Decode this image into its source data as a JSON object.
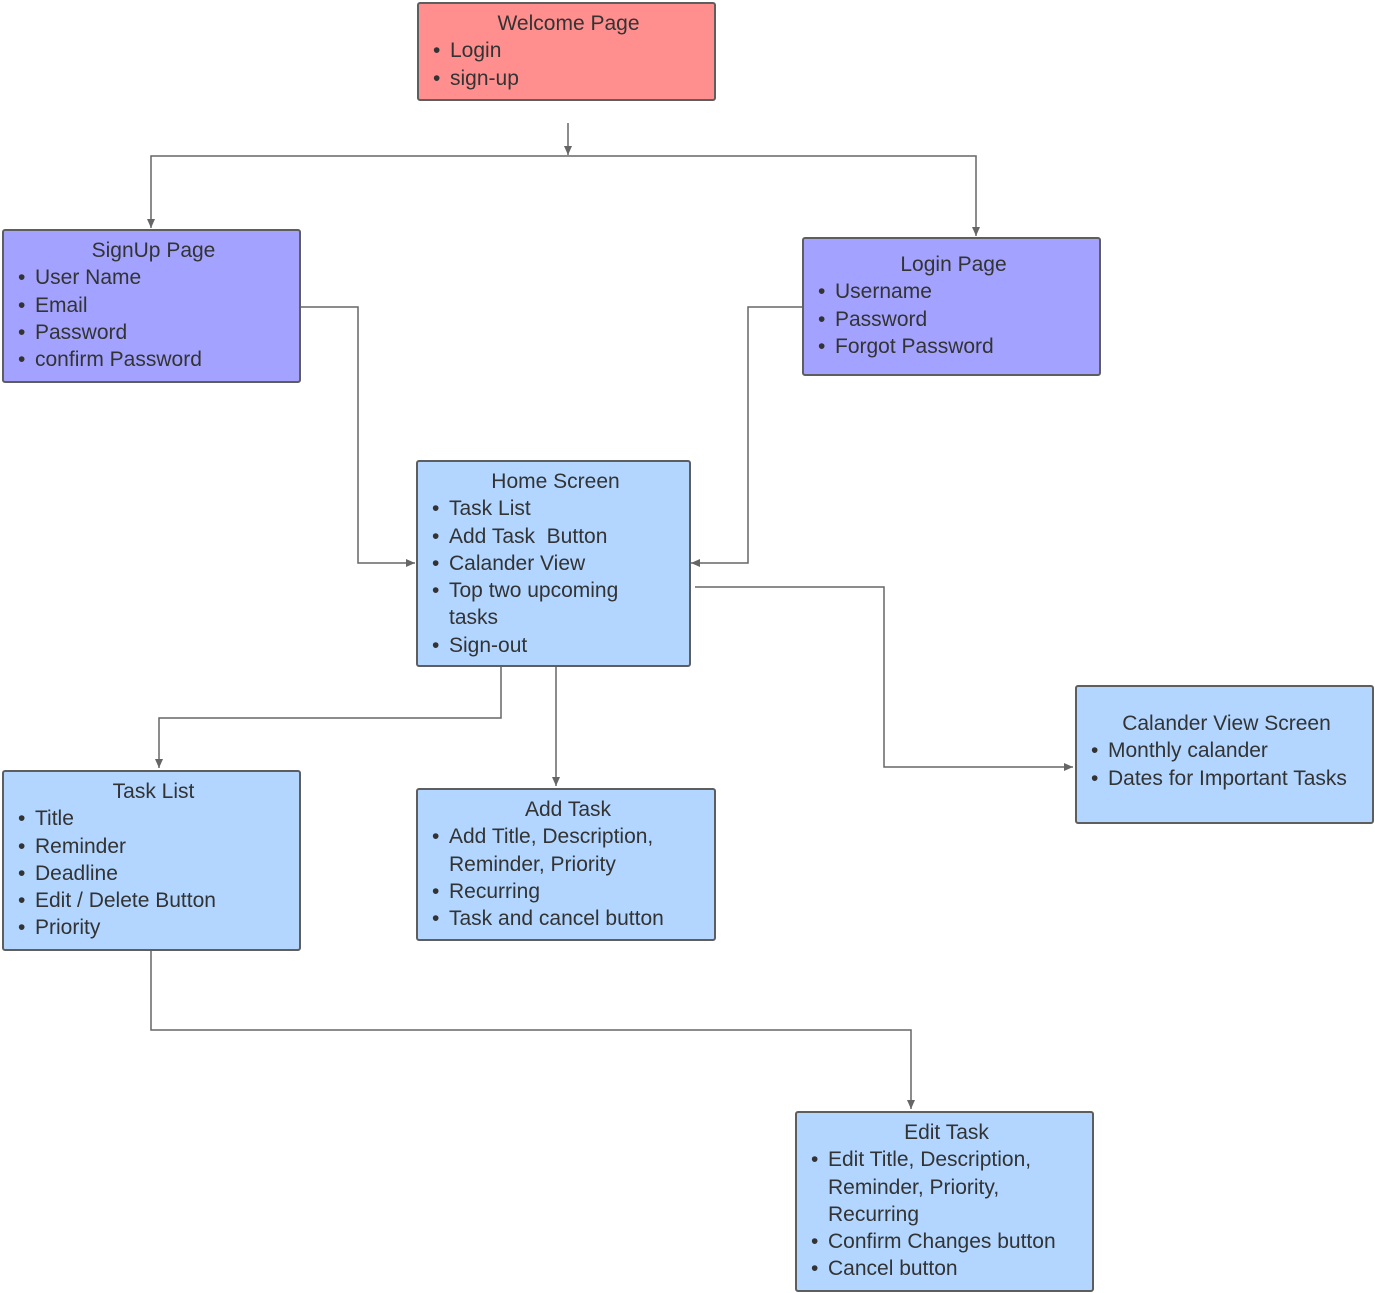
{
  "colors": {
    "welcome": "#FF8F8F",
    "auth": "#A3A3FF",
    "screen": "#B2D6FF",
    "border": "#5E5E5E",
    "connector": "#666666"
  },
  "nodes": {
    "welcome": {
      "title": "Welcome Page",
      "items": [
        "Login",
        "sign-up"
      ]
    },
    "signup": {
      "title": "SignUp Page",
      "items": [
        "User Name",
        "Email",
        "Password",
        "confirm Password"
      ]
    },
    "login": {
      "title": "Login Page",
      "items": [
        "Username",
        "Password",
        "Forgot Password"
      ]
    },
    "home": {
      "title": "Home Screen",
      "items": [
        "Task List",
        "Add Task  Button",
        "Calander View",
        "Top two upcoming tasks",
        "Sign-out"
      ]
    },
    "tasklist": {
      "title": "Task List",
      "items": [
        "Title",
        "Reminder",
        "Deadline",
        "Edit / Delete Button",
        "Priority"
      ]
    },
    "addtask": {
      "title": "Add Task",
      "items": [
        "Add Title, Description, Reminder, Priority",
        "Recurring",
        "Task and cancel button"
      ]
    },
    "calendar": {
      "title": "Calander View Screen",
      "items": [
        "Monthly calander",
        "Dates for Important Tasks"
      ]
    },
    "edittask": {
      "title": "Edit Task",
      "items": [
        "Edit Title, Description, Reminder, Priority, Recurring",
        "Confirm Changes button",
        "Cancel button"
      ]
    }
  }
}
